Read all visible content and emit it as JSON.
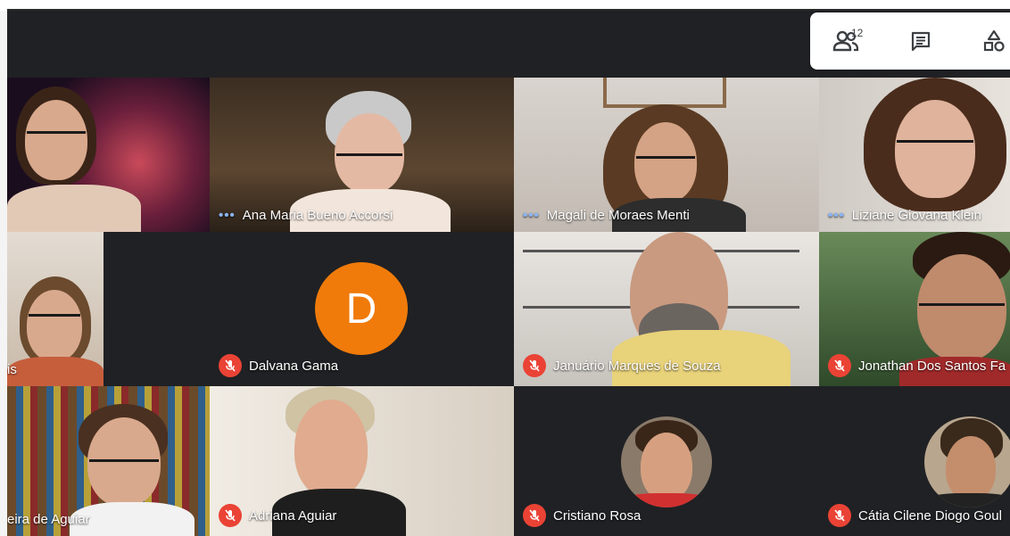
{
  "toolbar": {
    "participants_icon": "people-icon",
    "participants_count": "12",
    "chat_icon": "chat-icon",
    "activities_icon": "shapes-icon"
  },
  "tiles": [
    {
      "name": "",
      "muted": false
    },
    {
      "name": "Ana Maria Bueno Accorsi",
      "muted": false,
      "speaking_dots": "•••"
    },
    {
      "name": "Magali de Moraes Menti",
      "muted": false,
      "speaking_dots": "•••"
    },
    {
      "name": "Liziane Giovana Klein",
      "muted": false,
      "speaking_dots": "•••"
    },
    {
      "name": "is",
      "muted": false
    },
    {
      "name": "Dalvana Gama",
      "muted": true,
      "avatar_letter": "D"
    },
    {
      "name": "Januário Marques de Souza",
      "muted": true
    },
    {
      "name": "Jonathan Dos Santos Fa",
      "muted": true
    },
    {
      "name": "eira de Aguiar",
      "muted": false
    },
    {
      "name": "Adriana Aguiar",
      "muted": true
    },
    {
      "name": "Cristiano Rosa",
      "muted": true
    },
    {
      "name": "Cátia Cilene Diogo Goul",
      "muted": true
    }
  ],
  "colors": {
    "app_bar": "#202124",
    "tile_bg": "#3c4043",
    "avatar_d": "#f07b0a",
    "mic_off": "#ea4335",
    "speaking": "#8ab4f8"
  }
}
